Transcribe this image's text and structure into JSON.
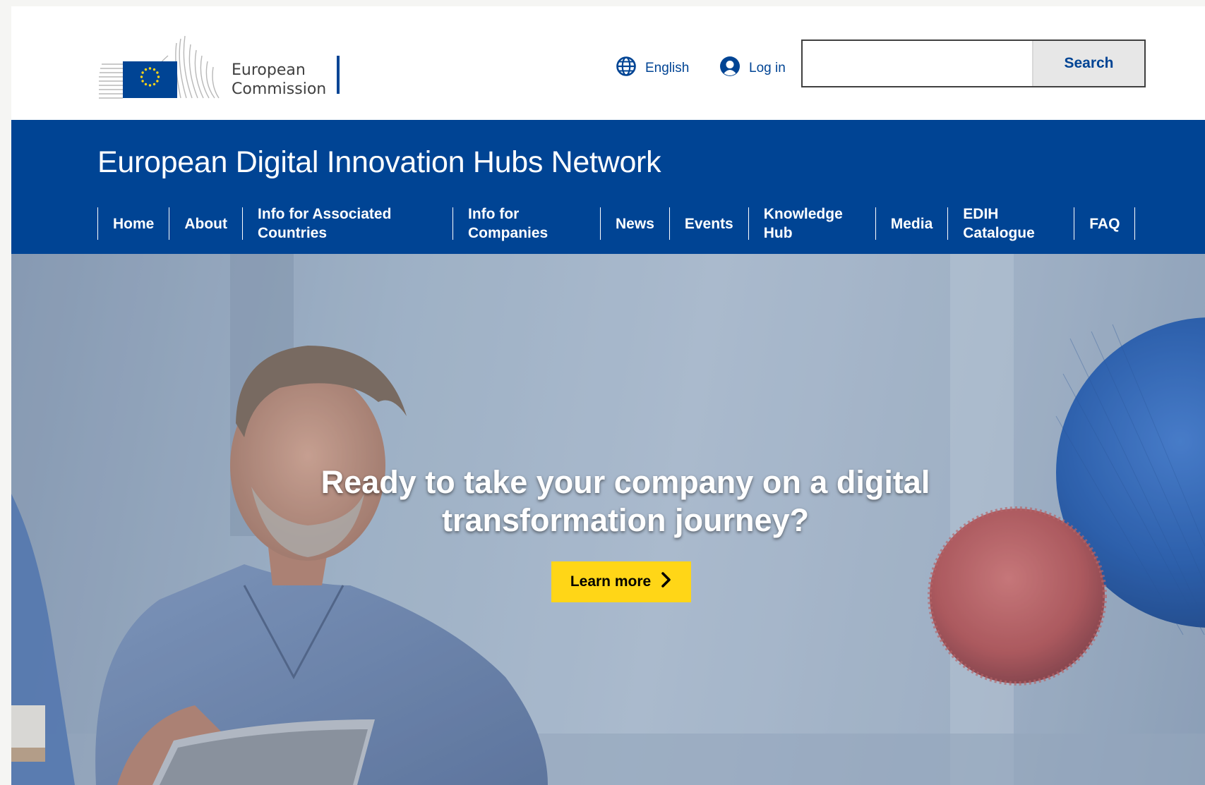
{
  "header": {
    "logo_line1": "European",
    "logo_line2": "Commission",
    "language_label": "English",
    "login_label": "Log in",
    "search_placeholder": "",
    "search_button": "Search"
  },
  "banner": {
    "site_title": "European Digital Innovation Hubs Network",
    "nav": [
      {
        "line1": "Home",
        "line2": ""
      },
      {
        "line1": "About",
        "line2": ""
      },
      {
        "line1": "Info for Associated",
        "line2": "Countries"
      },
      {
        "line1": "Info for",
        "line2": "Companies"
      },
      {
        "line1": "News",
        "line2": ""
      },
      {
        "line1": "Events",
        "line2": ""
      },
      {
        "line1": "Knowledge",
        "line2": "Hub"
      },
      {
        "line1": "Media",
        "line2": ""
      },
      {
        "line1": "EDIH",
        "line2": "Catalogue"
      },
      {
        "line1": "FAQ",
        "line2": ""
      }
    ]
  },
  "hero": {
    "heading_line1": "Ready to take your company on a digital",
    "heading_line2": "transformation journey?",
    "cta_label": "Learn more"
  },
  "colors": {
    "brand_blue": "#004494",
    "cta_yellow": "#ffd617",
    "text_white": "#ffffff"
  },
  "icons": {
    "language": "globe-icon",
    "login": "user-icon",
    "cta": "chevron-right-icon"
  }
}
